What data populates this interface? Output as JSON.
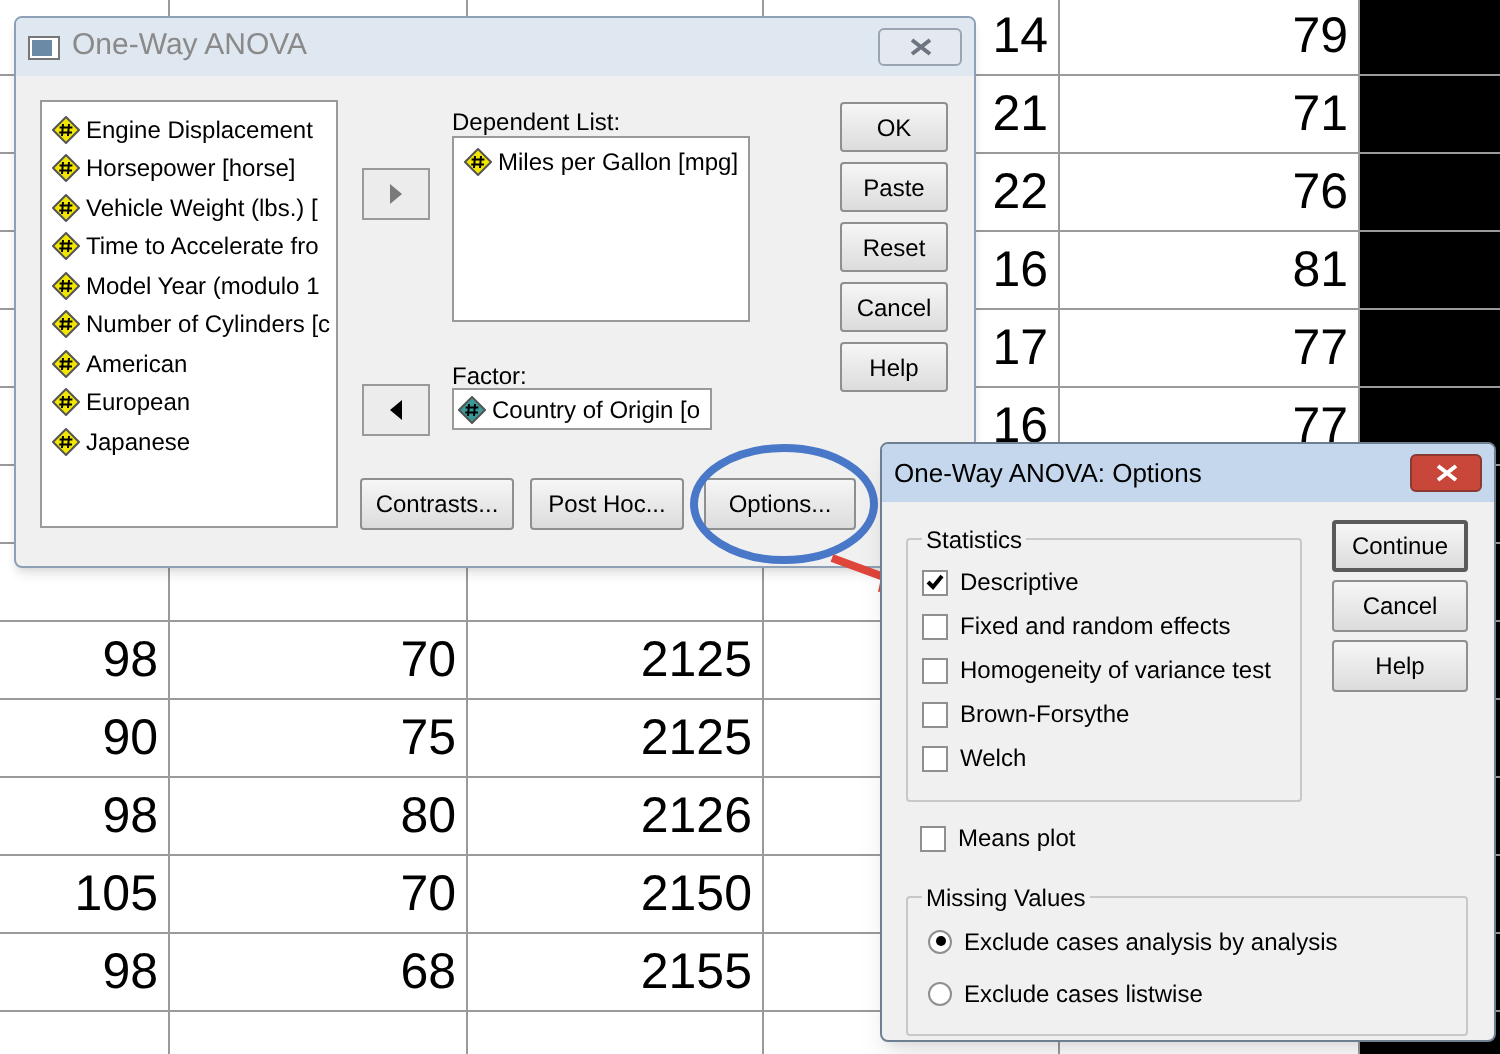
{
  "sheet": {
    "rows": [
      {
        "cells": [
          null,
          null,
          null,
          "14",
          "79"
        ]
      },
      {
        "cells": [
          null,
          null,
          null,
          "21",
          "71"
        ]
      },
      {
        "cells": [
          null,
          null,
          null,
          "22",
          "76"
        ]
      },
      {
        "cells": [
          null,
          null,
          null,
          "16",
          "81"
        ]
      },
      {
        "cells": [
          null,
          null,
          null,
          "17",
          "77"
        ]
      },
      {
        "cells": [
          null,
          null,
          null,
          "16",
          "77"
        ]
      },
      {
        "cells": [
          null,
          null,
          null,
          null,
          null
        ]
      },
      {
        "cells": [
          null,
          null,
          null,
          null,
          null
        ]
      },
      {
        "cells": [
          "98",
          "70",
          "2125",
          null,
          null
        ]
      },
      {
        "cells": [
          "90",
          "75",
          "2125",
          null,
          null
        ]
      },
      {
        "cells": [
          "98",
          "80",
          "2126",
          null,
          null
        ]
      },
      {
        "cells": [
          "105",
          "70",
          "2150",
          null,
          null
        ]
      },
      {
        "cells": [
          "98",
          "68",
          "2155",
          null,
          null
        ]
      },
      {
        "cells": [
          null,
          null,
          null,
          null,
          null
        ]
      }
    ]
  },
  "main_dialog": {
    "title": "One-Way ANOVA",
    "active": false,
    "variables": [
      {
        "label": "Engine Displacement",
        "kind": "scale"
      },
      {
        "label": "Horsepower [horse]",
        "kind": "scale"
      },
      {
        "label": "Vehicle Weight (lbs.) [",
        "kind": "scale"
      },
      {
        "label": "Time to Accelerate fro",
        "kind": "scale"
      },
      {
        "label": "Model Year (modulo 1",
        "kind": "scale"
      },
      {
        "label": "Number of Cylinders [c",
        "kind": "scale"
      },
      {
        "label": "American",
        "kind": "scale"
      },
      {
        "label": "European",
        "kind": "scale"
      },
      {
        "label": "Japanese",
        "kind": "scale"
      }
    ],
    "dependent_list": {
      "label": "Dependent List:",
      "items": [
        {
          "label": "Miles per Gallon [mpg]",
          "kind": "scale"
        }
      ]
    },
    "factor": {
      "label": "Factor:",
      "value": {
        "label": "Country of Origin [o",
        "kind": "nominal"
      }
    },
    "side_buttons": [
      "OK",
      "Paste",
      "Reset",
      "Cancel",
      "Help"
    ],
    "bottom_buttons": [
      "Contrasts...",
      "Post Hoc...",
      "Options..."
    ]
  },
  "options_dialog": {
    "title": "One-Way ANOVA: Options",
    "active": true,
    "statistics": {
      "label": "Statistics",
      "items": [
        {
          "label": "Descriptive",
          "checked": true
        },
        {
          "label": "Fixed and random effects",
          "checked": false
        },
        {
          "label": "Homogeneity of variance test",
          "checked": false
        },
        {
          "label": "Brown-Forsythe",
          "checked": false
        },
        {
          "label": "Welch",
          "checked": false
        }
      ]
    },
    "means_plot": {
      "label": "Means plot",
      "checked": false
    },
    "missing_values": {
      "label": "Missing Values",
      "items": [
        {
          "label": "Exclude cases analysis by analysis",
          "selected": true
        },
        {
          "label": "Exclude cases listwise",
          "selected": false
        }
      ]
    },
    "buttons": [
      "Continue",
      "Cancel",
      "Help"
    ]
  }
}
